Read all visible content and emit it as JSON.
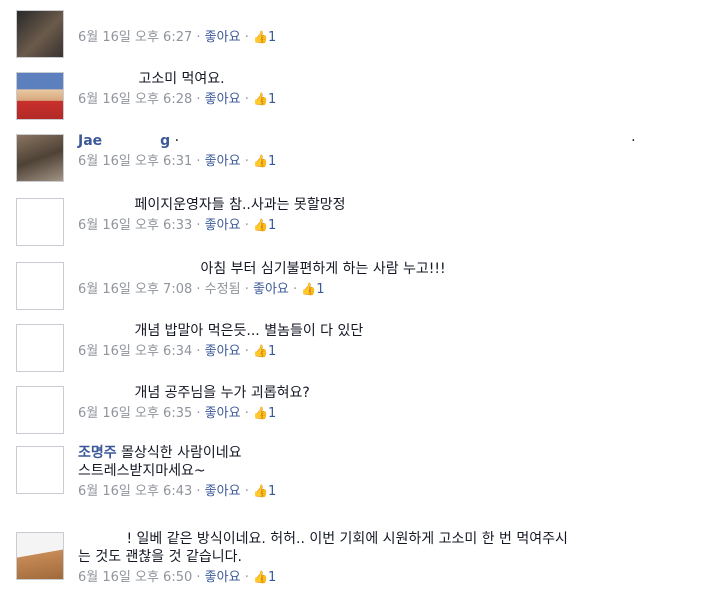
{
  "comments": [
    {
      "author": "",
      "text": "",
      "date": "6월 16일 오후 6:27",
      "edited": "",
      "like_label": "좋아요",
      "like_count": "1"
    },
    {
      "author": "",
      "text": "고소미 먹여요.",
      "date": "6월 16일 오후 6:28",
      "edited": "",
      "like_label": "좋아요",
      "like_count": "1"
    },
    {
      "author": "Jae",
      "author_tail": "g",
      "text": "·",
      "text_tail": "·",
      "date": "6월 16일 오후 6:31",
      "edited": "",
      "like_label": "좋아요",
      "like_count": "1"
    },
    {
      "author": "",
      "text": "페이지운영자들 참..사과는 못할망정",
      "date": "6월 16일 오후 6:33",
      "edited": "",
      "like_label": "좋아요",
      "like_count": "1"
    },
    {
      "author": "",
      "text": "아침 부터 심기불편하게 하는 사람 누고!!!",
      "date": "6월 16일 오후 7:08",
      "edited": "수정됨",
      "like_label": "좋아요",
      "like_count": "1"
    },
    {
      "author": "",
      "text": "개념 밥말아 먹은듯... 별놈들이 다 있단",
      "date": "6월 16일 오후 6:34",
      "edited": "",
      "like_label": "좋아요",
      "like_count": "1"
    },
    {
      "author": "",
      "text": "개념 공주님을 누가 괴롭혀요?",
      "date": "6월 16일 오후 6:35",
      "edited": "",
      "like_label": "좋아요",
      "like_count": "1"
    },
    {
      "author": "조명주",
      "text": "몰상식한 사람이네요",
      "text2": "스트레스받지마세요~",
      "date": "6월 16일 오후 6:43",
      "edited": "",
      "like_label": "좋아요",
      "like_count": "1"
    },
    {
      "author": "",
      "text": "! 일베 같은 방식이네요. 허허.. 이번 기회에 시원하게 고소미 한 번 먹여주시",
      "text2": "는 것도 괜찮을 것 같습니다.",
      "date": "6월 16일 오후 6:50",
      "edited": "",
      "like_label": "좋아요",
      "like_count": "1"
    }
  ]
}
